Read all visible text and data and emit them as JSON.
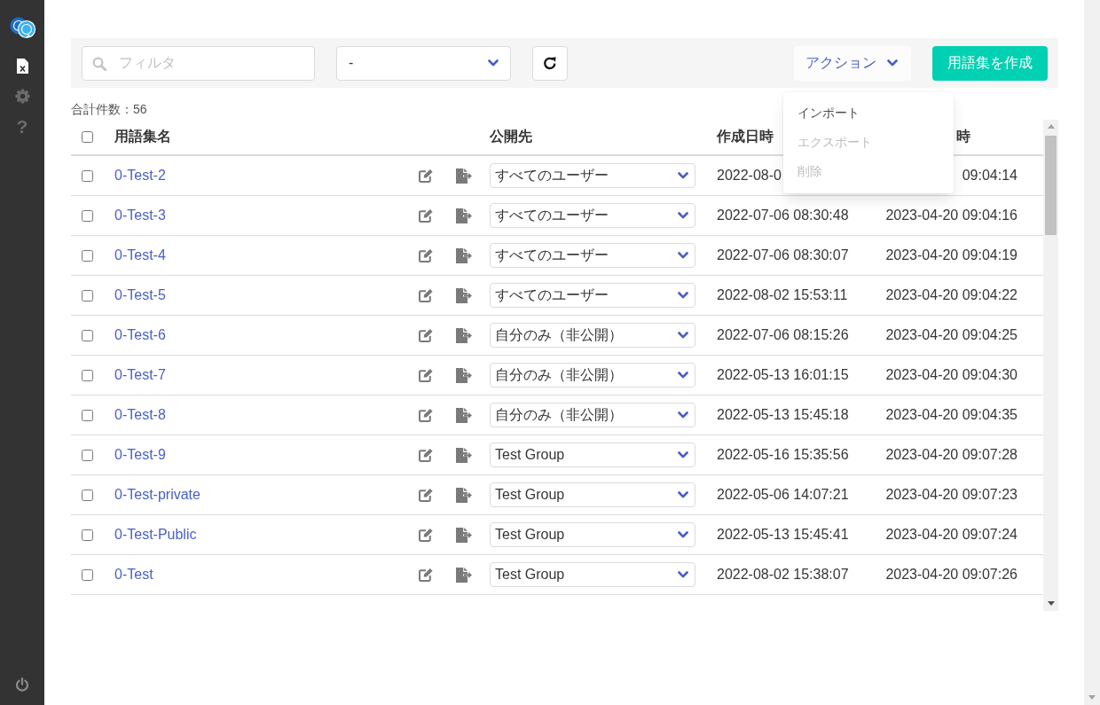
{
  "sidebar": {
    "nav": [
      {
        "kind": "file",
        "selected": true
      },
      {
        "kind": "settings",
        "selected": false
      },
      {
        "kind": "help",
        "selected": false,
        "glyph": "?"
      }
    ]
  },
  "toolbar": {
    "search": {
      "placeholder": "フィルタ"
    },
    "filter_select": {
      "value": "-"
    },
    "action_button": {
      "label": "アクション",
      "expanded": true
    },
    "create_button": {
      "label": "用語集を作成"
    }
  },
  "action_menu": {
    "items": [
      {
        "label": "インポート",
        "disabled": false
      },
      {
        "label": "エクスポート",
        "disabled": true
      },
      {
        "label": "削除",
        "disabled": true
      }
    ]
  },
  "total_count": "合計件数：56",
  "table": {
    "select_all": {
      "checked": false
    },
    "columns": {
      "name": "用語集名",
      "visibility": "公開先",
      "created": "作成日時",
      "updated": "時"
    },
    "rows": [
      {
        "checked": false,
        "name": "0-Test-2",
        "visibility": "すべてのユーザー",
        "created": "2022-08-0",
        "updated": "09:04:14"
      },
      {
        "checked": false,
        "name": "0-Test-3",
        "visibility": "すべてのユーザー",
        "created": "2022-07-06 08:30:48",
        "updated": "2023-04-20 09:04:16"
      },
      {
        "checked": false,
        "name": "0-Test-4",
        "visibility": "すべてのユーザー",
        "created": "2022-07-06 08:30:07",
        "updated": "2023-04-20 09:04:19"
      },
      {
        "checked": false,
        "name": "0-Test-5",
        "visibility": "すべてのユーザー",
        "created": "2022-08-02 15:53:11",
        "updated": "2023-04-20 09:04:22"
      },
      {
        "checked": false,
        "name": "0-Test-6",
        "visibility": "自分のみ（非公開）",
        "created": "2022-07-06 08:15:26",
        "updated": "2023-04-20 09:04:25"
      },
      {
        "checked": false,
        "name": "0-Test-7",
        "visibility": "自分のみ（非公開）",
        "created": "2022-05-13 16:01:15",
        "updated": "2023-04-20 09:04:30"
      },
      {
        "checked": false,
        "name": "0-Test-8",
        "visibility": "自分のみ（非公開）",
        "created": "2022-05-13 15:45:18",
        "updated": "2023-04-20 09:04:35"
      },
      {
        "checked": false,
        "name": "0-Test-9",
        "visibility": "Test Group",
        "created": "2022-05-16 15:35:56",
        "updated": "2023-04-20 09:07:28"
      },
      {
        "checked": false,
        "name": "0-Test-private",
        "visibility": "Test Group",
        "created": "2022-05-06 14:07:21",
        "updated": "2023-04-20 09:07:23"
      },
      {
        "checked": false,
        "name": "0-Test-Public",
        "visibility": "Test Group",
        "created": "2022-05-13 15:45:41",
        "updated": "2023-04-20 09:07:24"
      },
      {
        "checked": false,
        "name": "0-Test",
        "visibility": "Test Group",
        "created": "2022-08-02 15:38:07",
        "updated": "2023-04-20 09:07:26"
      }
    ]
  }
}
